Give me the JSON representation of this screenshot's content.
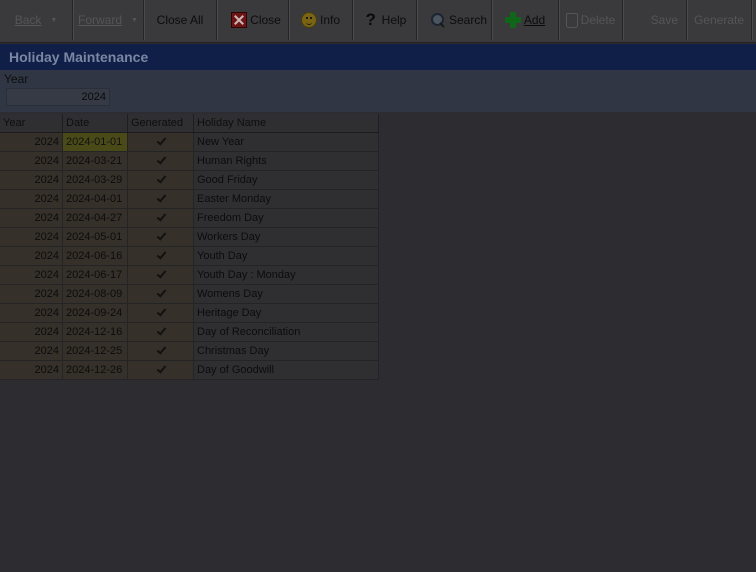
{
  "toolbar": {
    "back_label": "Back",
    "forward_label": "Forward",
    "close_all_label": "Close All",
    "close_label": "Close",
    "info_label": "Info",
    "help_label": "Help",
    "search_label": "Search",
    "add_label": "Add",
    "delete_label": "Delete",
    "save_label": "Save",
    "generate_label": "Generate"
  },
  "window": {
    "title": "Holiday Maintenance"
  },
  "filter": {
    "year_label": "Year",
    "year_value": "2024"
  },
  "grid": {
    "columns": [
      "Year",
      "Date",
      "Generated",
      "Holiday Name"
    ],
    "rows": [
      {
        "year": "2024",
        "date": "2024-01-01",
        "generated": true,
        "name": "New Year"
      },
      {
        "year": "2024",
        "date": "2024-03-21",
        "generated": true,
        "name": "Human Rights"
      },
      {
        "year": "2024",
        "date": "2024-03-29",
        "generated": true,
        "name": "Good Friday"
      },
      {
        "year": "2024",
        "date": "2024-04-01",
        "generated": true,
        "name": "Easter Monday"
      },
      {
        "year": "2024",
        "date": "2024-04-27",
        "generated": true,
        "name": "Freedom Day"
      },
      {
        "year": "2024",
        "date": "2024-05-01",
        "generated": true,
        "name": "Workers Day"
      },
      {
        "year": "2024",
        "date": "2024-06-16",
        "generated": true,
        "name": "Youth Day"
      },
      {
        "year": "2024",
        "date": "2024-06-17",
        "generated": true,
        "name": "Youth Day : Monday"
      },
      {
        "year": "2024",
        "date": "2024-08-09",
        "generated": true,
        "name": "Womens Day"
      },
      {
        "year": "2024",
        "date": "2024-09-24",
        "generated": true,
        "name": "Heritage Day"
      },
      {
        "year": "2024",
        "date": "2024-12-16",
        "generated": true,
        "name": "Day of Reconciliation"
      },
      {
        "year": "2024",
        "date": "2024-12-25",
        "generated": true,
        "name": "Christmas Day"
      },
      {
        "year": "2024",
        "date": "2024-12-26",
        "generated": true,
        "name": "Day of Goodwill"
      }
    ]
  }
}
